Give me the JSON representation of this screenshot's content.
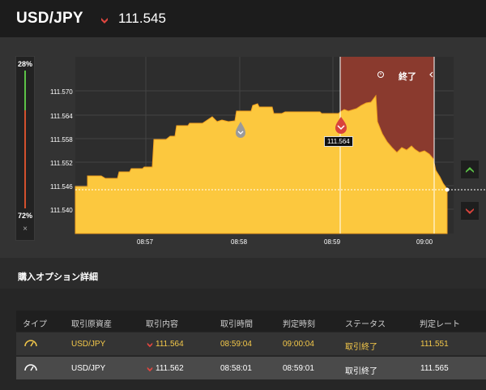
{
  "header": {
    "pair": "USD/JPY",
    "price": "111.545"
  },
  "vbar": {
    "top_pct": "28%",
    "bottom_pct": "72%",
    "close": "×"
  },
  "chart": {
    "y_ticks": [
      "111.570",
      "111.564",
      "111.558",
      "111.552",
      "111.546",
      "111.540"
    ],
    "x_ticks": [
      "08:57",
      "08:58",
      "08:59",
      "09:00"
    ],
    "end_label": "終了",
    "tooltip": "111.564",
    "colors": {
      "area": "#fcc83e",
      "expired": "#8a3a2e",
      "up": "#5cc247",
      "down": "#d9433c"
    }
  },
  "section": {
    "title": "購入オプション詳細"
  },
  "table": {
    "headers": [
      "タイプ",
      "取引原資産",
      "取引内容",
      "取引時間",
      "判定時刻",
      "ステータス",
      "判定レート"
    ],
    "rows": [
      {
        "type_icon": "gauge-icon",
        "asset": "USD/JPY",
        "price": "111.564",
        "time": "08:59:04",
        "judge_time": "09:00:04",
        "status": "取引終了",
        "rate": "111.551"
      },
      {
        "type_icon": "gauge-icon",
        "asset": "USD/JPY",
        "price": "111.562",
        "time": "08:58:01",
        "judge_time": "08:59:01",
        "status": "取引終了",
        "rate": "111.565"
      }
    ]
  }
}
